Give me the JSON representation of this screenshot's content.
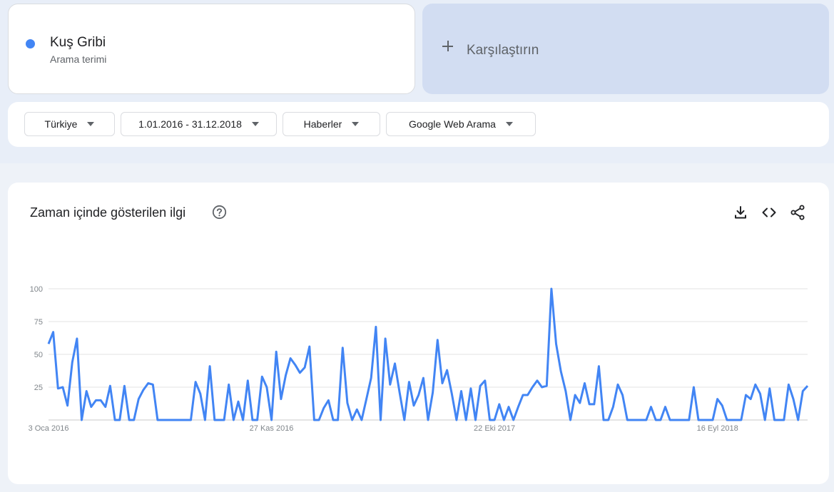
{
  "colors": {
    "series": "#4285f4",
    "compare_bg": "#d2ddf2",
    "grid": "#e3e3e3",
    "axis_text": "#80868b"
  },
  "term": {
    "title": "Kuş Gribi",
    "subtitle": "Arama terimi"
  },
  "compare": {
    "icon": "plus-icon",
    "label": "Karşılaştırın"
  },
  "filters": [
    {
      "label": "Türkiye",
      "icon": "caret-down-icon"
    },
    {
      "label": "1.01.2016 - 31.12.2018",
      "icon": "caret-down-icon"
    },
    {
      "label": "Haberler",
      "icon": "caret-down-icon"
    },
    {
      "label": "Google Web Arama",
      "icon": "caret-down-icon"
    }
  ],
  "chart_card": {
    "title": "Zaman içinde gösterilen ilgi",
    "help_icon": "help-circle-icon",
    "actions": [
      "download-icon",
      "embed-code-icon",
      "share-icon"
    ]
  },
  "chart_data": {
    "type": "line",
    "title": "",
    "xlabel": "",
    "ylabel": "",
    "ylim": [
      0,
      100
    ],
    "y_ticks": [
      100,
      75,
      50,
      25
    ],
    "x_ticks": [
      "3 Oca 2016",
      "27 Kas 2016",
      "22 Eki 2017",
      "16 Eyl 2018"
    ],
    "x_tick_index": [
      0,
      47,
      94,
      141
    ],
    "grid": true,
    "legend": "none",
    "series": [
      {
        "values": [
          58,
          67,
          24,
          25,
          11,
          44,
          62,
          0,
          22,
          10,
          15,
          15,
          10,
          26,
          0,
          0,
          26,
          0,
          0,
          16,
          23,
          28,
          27,
          0,
          0,
          0,
          0,
          0,
          0,
          0,
          0,
          29,
          20,
          0,
          41,
          0,
          0,
          0,
          27,
          0,
          14,
          0,
          30,
          0,
          0,
          33,
          25,
          0,
          52,
          16,
          34,
          47,
          42,
          36,
          40,
          56,
          0,
          0,
          9,
          15,
          0,
          0,
          55,
          13,
          0,
          8,
          0,
          16,
          32,
          71,
          0,
          62,
          27,
          43,
          21,
          0,
          29,
          11,
          19,
          32,
          0,
          21,
          61,
          28,
          38,
          20,
          0,
          22,
          0,
          24,
          0,
          26,
          30,
          0,
          0,
          12,
          0,
          10,
          0,
          10,
          19,
          19,
          25,
          30,
          25,
          26,
          100,
          58,
          37,
          22,
          0,
          19,
          13,
          28,
          12,
          12,
          41,
          0,
          0,
          10,
          27,
          19,
          0,
          0,
          0,
          0,
          0,
          10,
          0,
          0,
          10,
          0,
          0,
          0,
          0,
          0,
          25,
          0,
          0,
          0,
          0,
          16,
          11,
          0,
          0,
          0,
          0,
          19,
          16,
          27,
          20,
          0,
          24,
          0,
          0,
          0,
          27,
          16,
          0,
          22,
          26
        ]
      }
    ]
  }
}
